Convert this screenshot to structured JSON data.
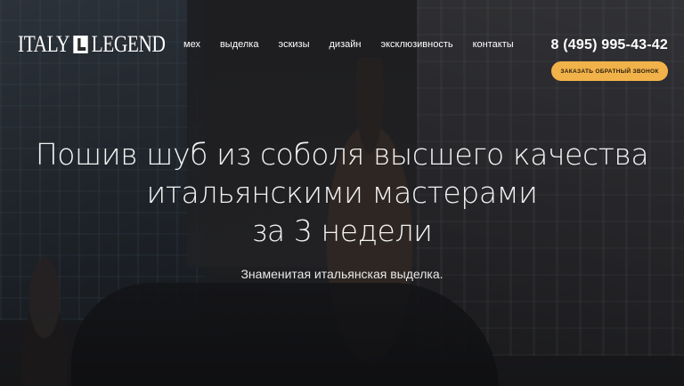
{
  "header": {
    "logo_left": "ITALY",
    "logo_right": "LEGEND",
    "nav": [
      "мех",
      "выделка",
      "эскизы",
      "дизайн",
      "эксклюзивность",
      "контакты"
    ],
    "phone": "8 (495) 995-43-42",
    "callback_button": "Заказать обратный звонок"
  },
  "hero": {
    "title_lines": [
      "Пошив шуб из соболя высшего качества",
      "итальянскими мастерами",
      "за 3 недели"
    ],
    "subtitle": "Знаменитая итальянская выделка."
  },
  "colors": {
    "accent": "#f2b24a",
    "text": "#ffffff"
  }
}
